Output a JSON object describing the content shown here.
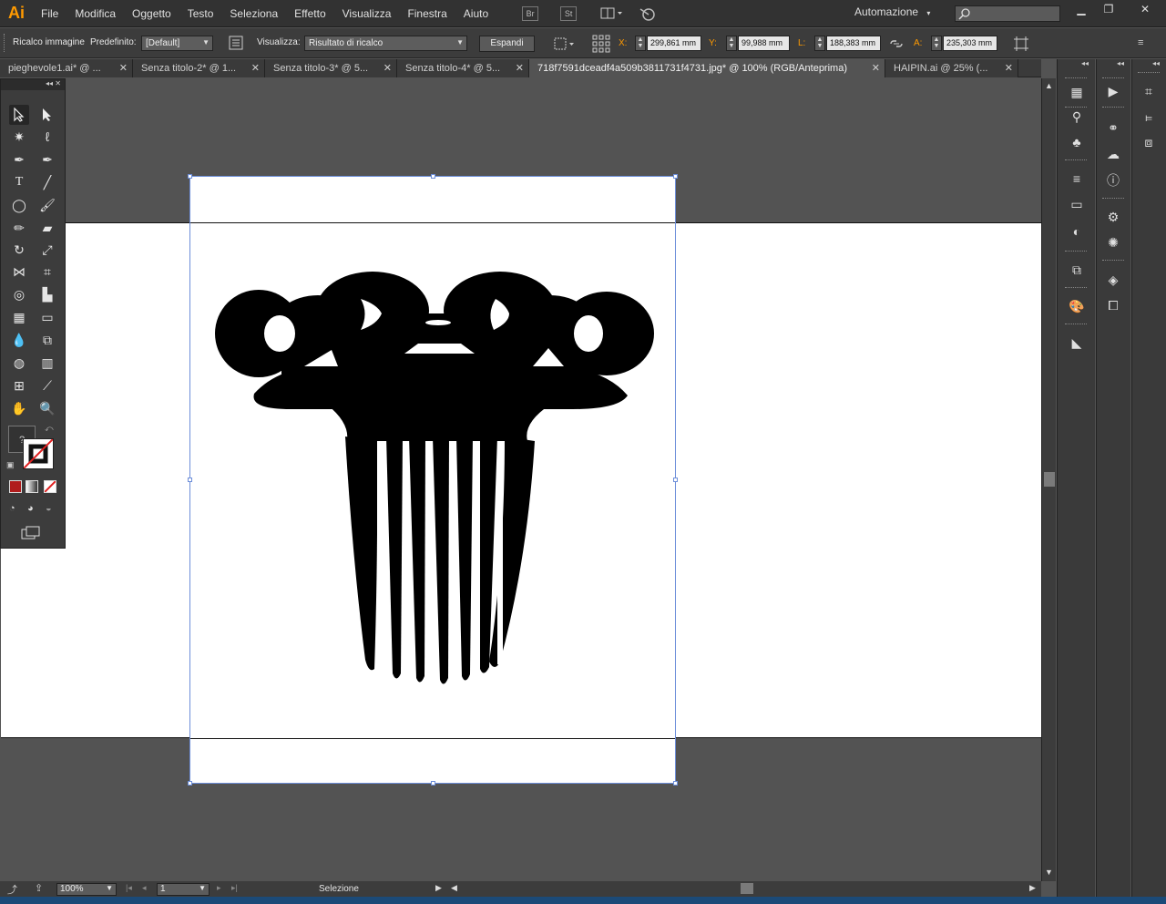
{
  "app": {
    "logo": "Ai"
  },
  "menu": [
    "File",
    "Modifica",
    "Oggetto",
    "Testo",
    "Seleziona",
    "Effetto",
    "Visualizza",
    "Finestra",
    "Aiuto"
  ],
  "menubar_icons": {
    "bridge": "Br",
    "stock": "St"
  },
  "workspace": "Automazione",
  "search_placeholder": "",
  "control": {
    "title": "Ricalco immagine",
    "preset_label": "Predefinito:",
    "preset_value": "[Default]",
    "view_label": "Visualizza:",
    "view_value": "Risultato di ricalco",
    "expand_label": "Espandi",
    "x_label": "X:",
    "x_value": "299,861 mm",
    "y_label": "Y:",
    "y_value": "99,988 mm",
    "w_label": "L:",
    "w_value": "188,383 mm",
    "h_label": "A:",
    "h_value": "235,303 mm"
  },
  "tabs": [
    {
      "label": "pieghevole1.ai* @ ...",
      "active": false
    },
    {
      "label": "Senza titolo-2* @ 1...",
      "active": false
    },
    {
      "label": "Senza titolo-3* @ 5...",
      "active": false
    },
    {
      "label": "Senza titolo-4* @ 5...",
      "active": false
    },
    {
      "label": "718f7591dceadf4a509b3811731f4731.jpg* @ 100% (RGB/Anteprima)",
      "active": true
    },
    {
      "label": "HAIPIN.ai @ 25% (...",
      "active": false
    }
  ],
  "status": {
    "zoom": "100%",
    "page": "1",
    "tool_name": "Selezione"
  },
  "colors": {
    "accent": "#ff9a00",
    "selection": "#6d8ed9",
    "canvas_bg": "#535353",
    "artboard": "#ffffff"
  }
}
